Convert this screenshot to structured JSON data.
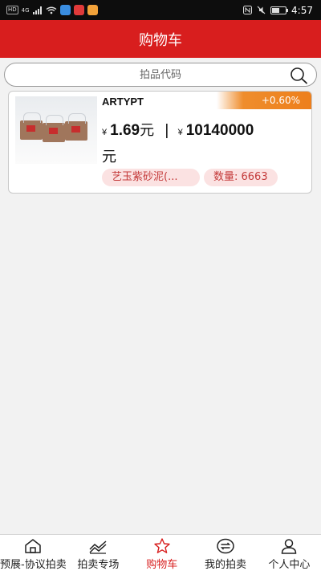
{
  "status_bar": {
    "network_tag": "HD",
    "signal_text": "4G",
    "time": "4:57",
    "battery_level": 0.55,
    "app_colors": [
      "#3a8de0",
      "#e03a3a",
      "#f2a23a"
    ]
  },
  "header": {
    "title": "购物车"
  },
  "search": {
    "placeholder": "拍品代码",
    "value": ""
  },
  "items": [
    {
      "name": "ARTYPT",
      "change": "+0.60%",
      "currency_symbol": "¥",
      "unit_price": "1.69",
      "separator": "|",
      "total": "10140000",
      "unit": "元",
      "product_name": "艺玉紫砂泥(...",
      "quantity_label": "数量: 6663"
    }
  ],
  "nav": {
    "items": [
      {
        "label": "预展-协议拍卖",
        "icon": "home-icon"
      },
      {
        "label": "拍卖专场",
        "icon": "trend-chart-icon"
      },
      {
        "label": "购物车",
        "icon": "star-icon",
        "active": true
      },
      {
        "label": "我的拍卖",
        "icon": "swap-icon"
      },
      {
        "label": "个人中心",
        "icon": "user-icon"
      }
    ]
  },
  "colors": {
    "brand_red": "#d81e1e",
    "change_orange": "#ed7f1c",
    "tag_bg": "#fbe2e2",
    "tag_text": "#c43a3a"
  }
}
